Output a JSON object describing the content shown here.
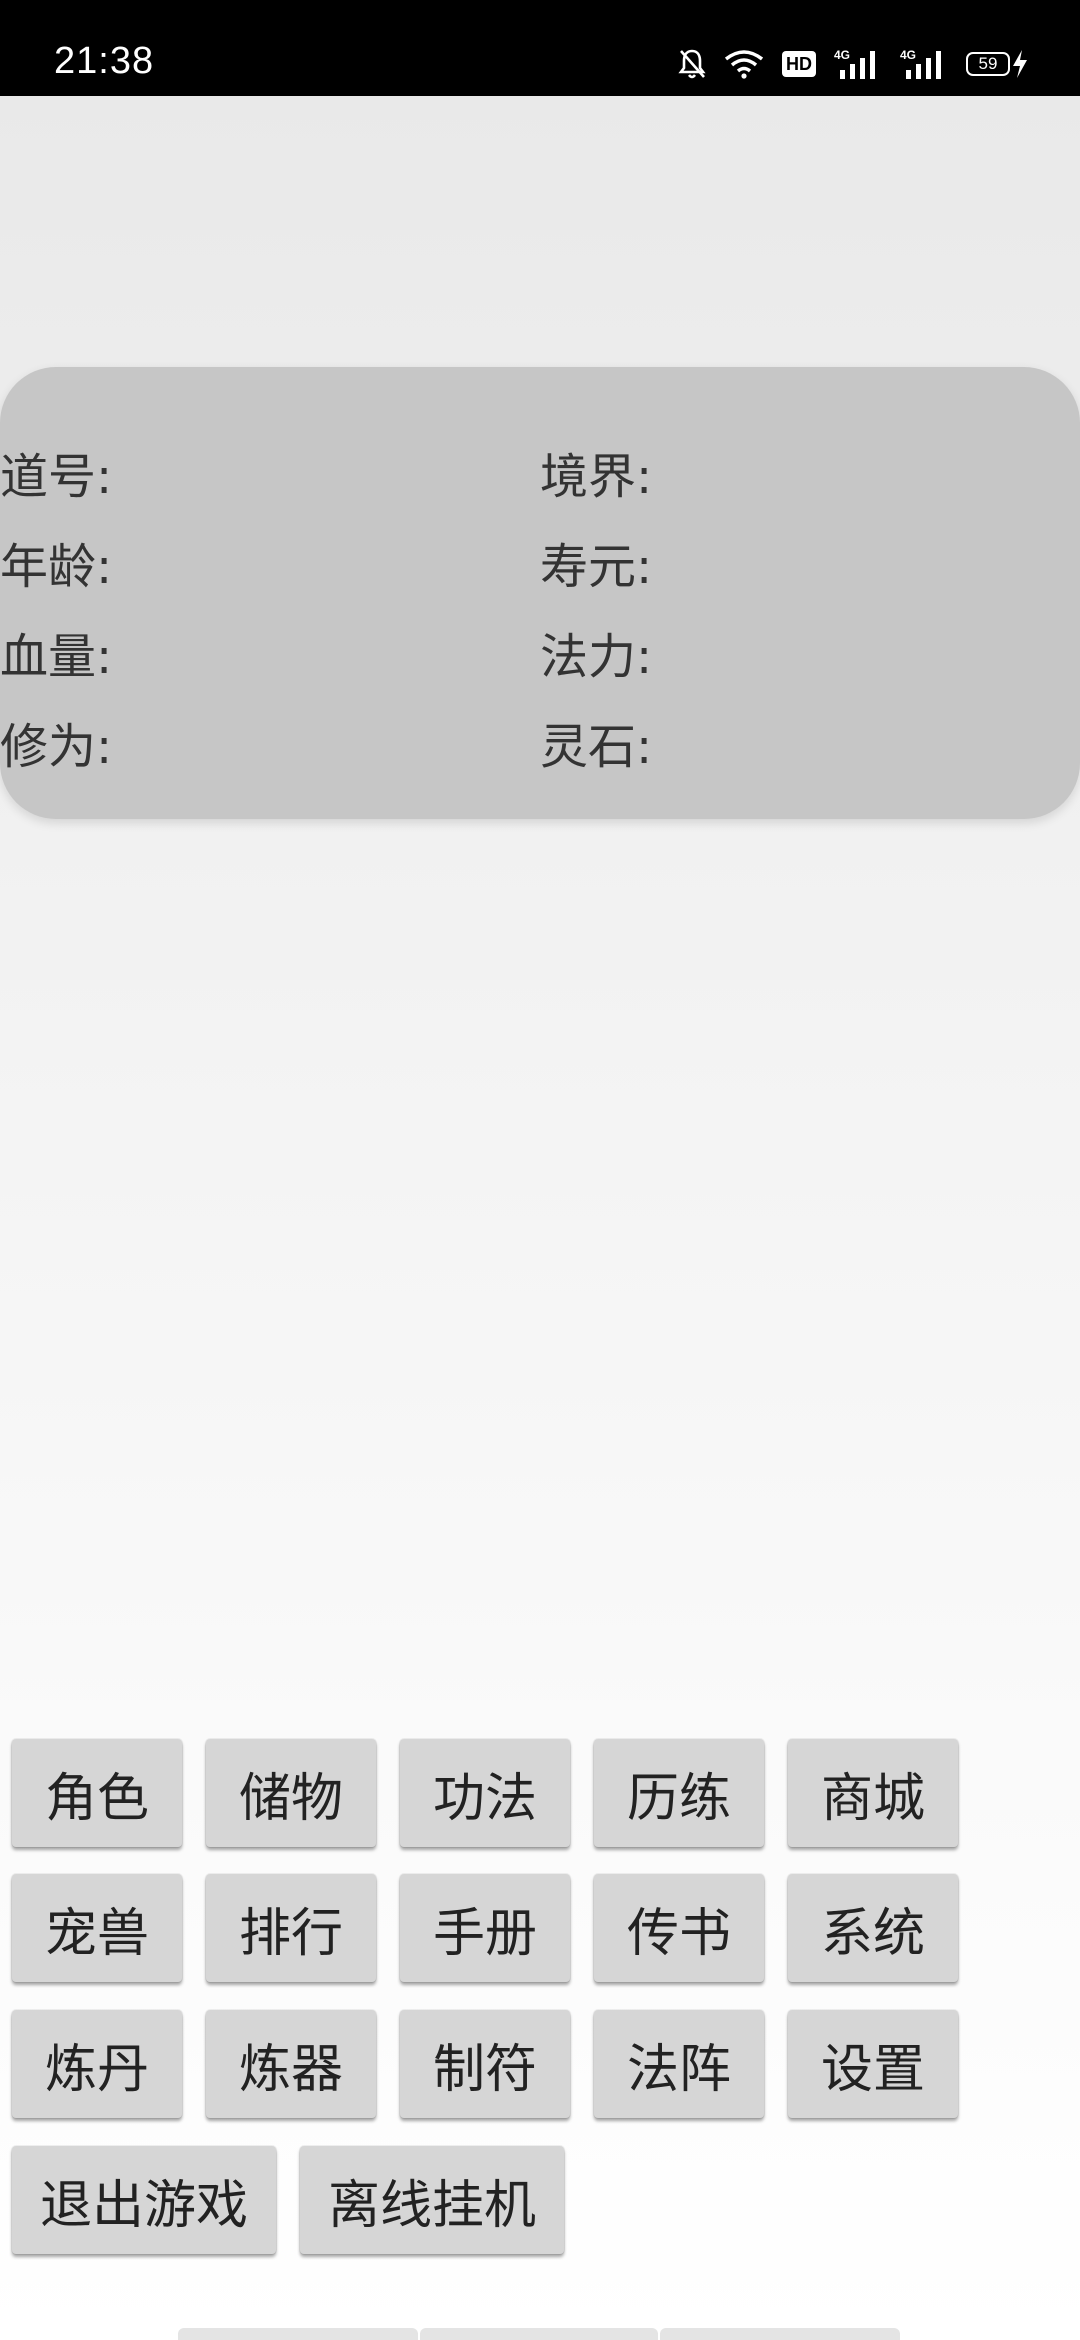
{
  "status_bar": {
    "time": "21:38",
    "net1": "4G",
    "net2": "4G",
    "battery": "59",
    "hd": "HD"
  },
  "info": {
    "dao_hao": "道号:",
    "jing_jie": "境界:",
    "nian_ling": "年龄:",
    "shou_yuan": "寿元:",
    "xue_liang": "血量:",
    "fa_li": "法力:",
    "xiu_wei": "修为:",
    "ling_shi": "灵石:"
  },
  "menu": {
    "jue_se": "角色",
    "chu_wu": "储物",
    "gong_fa": "功法",
    "li_lian": "历练",
    "shang_cheng": "商城",
    "chong_shou": "宠兽",
    "pai_hang": "排行",
    "shou_ce": "手册",
    "chuan_shu": "传书",
    "xi_tong": "系统",
    "lian_dan": "炼丹",
    "lian_qi": "炼器",
    "zhi_fu": "制符",
    "fa_zhen": "法阵",
    "she_zhi": "设置",
    "tui_chu": "退出游戏",
    "li_xian": "离线挂机"
  }
}
